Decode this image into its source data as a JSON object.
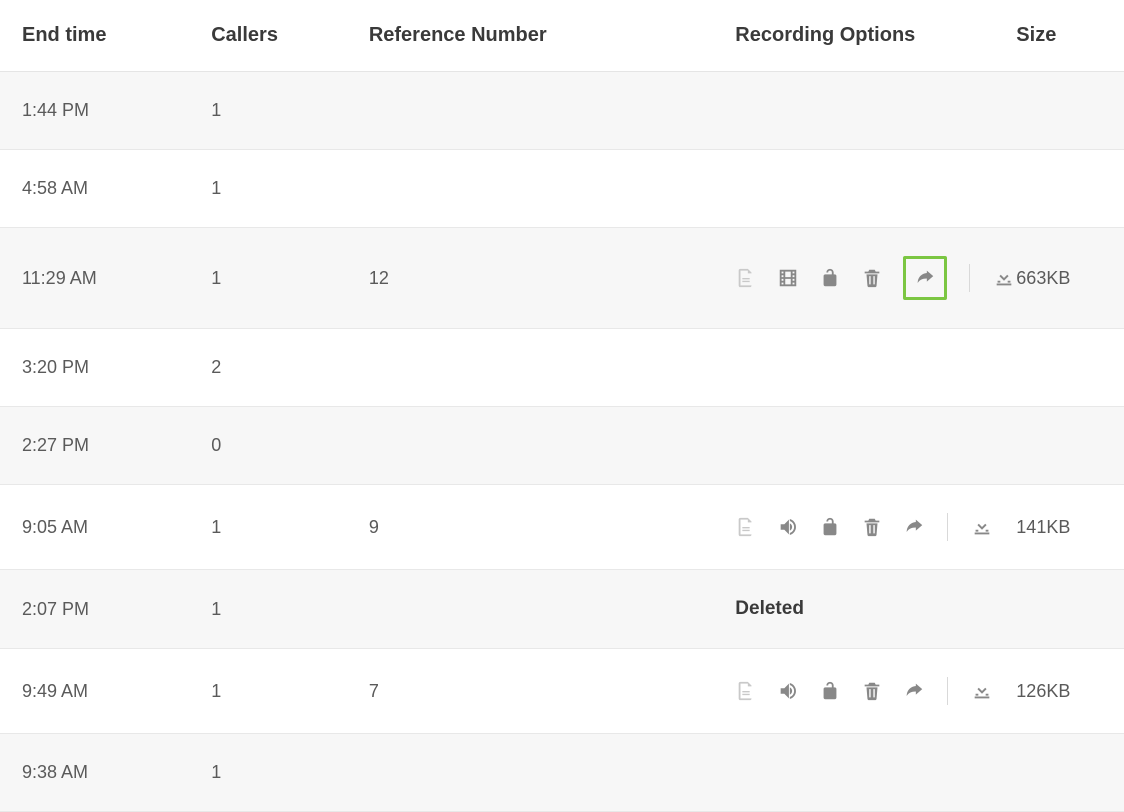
{
  "headers": {
    "end_time": "End time",
    "callers": "Callers",
    "reference": "Reference Number",
    "options": "Recording Options",
    "size": "Size"
  },
  "deleted_label": "Deleted",
  "rows": [
    {
      "end_time": "1:44 PM",
      "callers": "1",
      "reference": "",
      "options_type": "none",
      "size": ""
    },
    {
      "end_time": "4:58 AM",
      "callers": "1",
      "reference": "",
      "options_type": "none",
      "size": ""
    },
    {
      "end_time": "11:29 AM",
      "callers": "1",
      "reference": "12",
      "options_type": "video_highlight",
      "size": "663KB"
    },
    {
      "end_time": "3:20 PM",
      "callers": "2",
      "reference": "",
      "options_type": "none",
      "size": ""
    },
    {
      "end_time": "2:27 PM",
      "callers": "0",
      "reference": "",
      "options_type": "none",
      "size": ""
    },
    {
      "end_time": "9:05 AM",
      "callers": "1",
      "reference": "9",
      "options_type": "audio",
      "size": "141KB"
    },
    {
      "end_time": "2:07 PM",
      "callers": "1",
      "reference": "",
      "options_type": "deleted",
      "size": ""
    },
    {
      "end_time": "9:49 AM",
      "callers": "1",
      "reference": "7",
      "options_type": "audio",
      "size": "126KB"
    },
    {
      "end_time": "9:38 AM",
      "callers": "1",
      "reference": "",
      "options_type": "none",
      "size": ""
    }
  ]
}
